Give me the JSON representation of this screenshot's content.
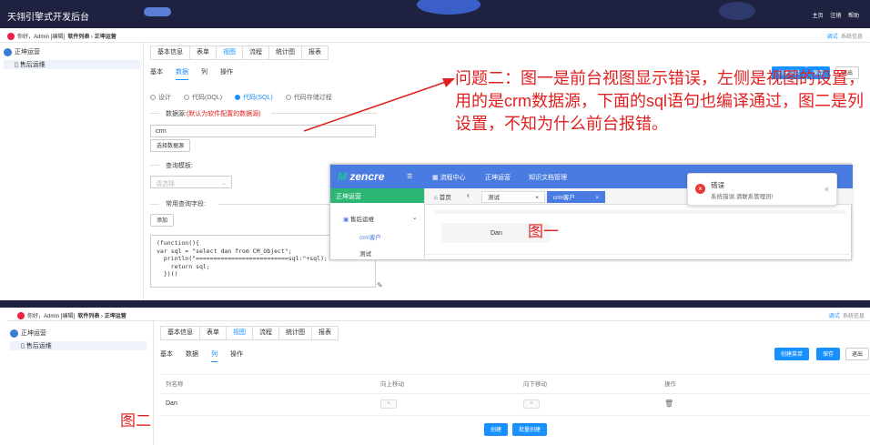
{
  "app_title": "天翎引擎式开发后台",
  "top_right": {
    "home": "主页",
    "logout": "注销",
    "help": "帮助"
  },
  "sub": {
    "greeting": "你好，Admin [编辑]",
    "crumb1": "软件列表",
    "crumb2": "正坤运营",
    "debug": "调试",
    "sysinfo": "系统信息"
  },
  "sidebar": {
    "root": "正坤运营",
    "child": "售后运维"
  },
  "tabs": [
    "基本信息",
    "表单",
    "视图",
    "流程",
    "统计图",
    "报表"
  ],
  "subtabs": [
    "基本",
    "数据",
    "列",
    "操作"
  ],
  "buttons": {
    "create_form": "创建菜单",
    "save": "保存",
    "exit": "退出",
    "create_form2": "创建菜单"
  },
  "radios": [
    "设计",
    "代码(DQL)",
    "代码(SQL)",
    "代码存储过程"
  ],
  "datasource": {
    "label": "数据源:",
    "hint": "(默认为软件配置的数据源)",
    "value": "crm",
    "choose": "选择数据源"
  },
  "query_template": {
    "label": "查询模板:",
    "placeholder": "请选择"
  },
  "common_fields": {
    "label": "常用查询字段:",
    "add": "添加"
  },
  "code": "(function(){\nvar sql = \"select dan from CM_Object\";\n  println(\"==========================sql:\"+sql);\n    return sql;\n  })()",
  "annotation": "问题二：图一是前台视图显示错误，左侧是视图的设置，用的是crm数据源，下面的sql语句也编译通过，图二是列设置，不知为什么前台报错。",
  "fig1": {
    "logo": "zencre",
    "nav": [
      "流程中心",
      "正坤运营",
      "知识文档管理"
    ],
    "side_header": "正坤运营",
    "side_group": "售后运维",
    "side_items": [
      "crm客户",
      "测试"
    ],
    "tabs": [
      "首页",
      "测试",
      "crm客户"
    ],
    "cell": "Dan",
    "label": "图一"
  },
  "error": {
    "title": "错误",
    "msg": "系统错误,请联系管理员!"
  },
  "fig2": {
    "label": "图二",
    "columns": [
      "列名称",
      "向上移动",
      "向下移动",
      "操作"
    ],
    "row_name": "Dan",
    "create": "创建",
    "batch_create": "批量创建"
  }
}
